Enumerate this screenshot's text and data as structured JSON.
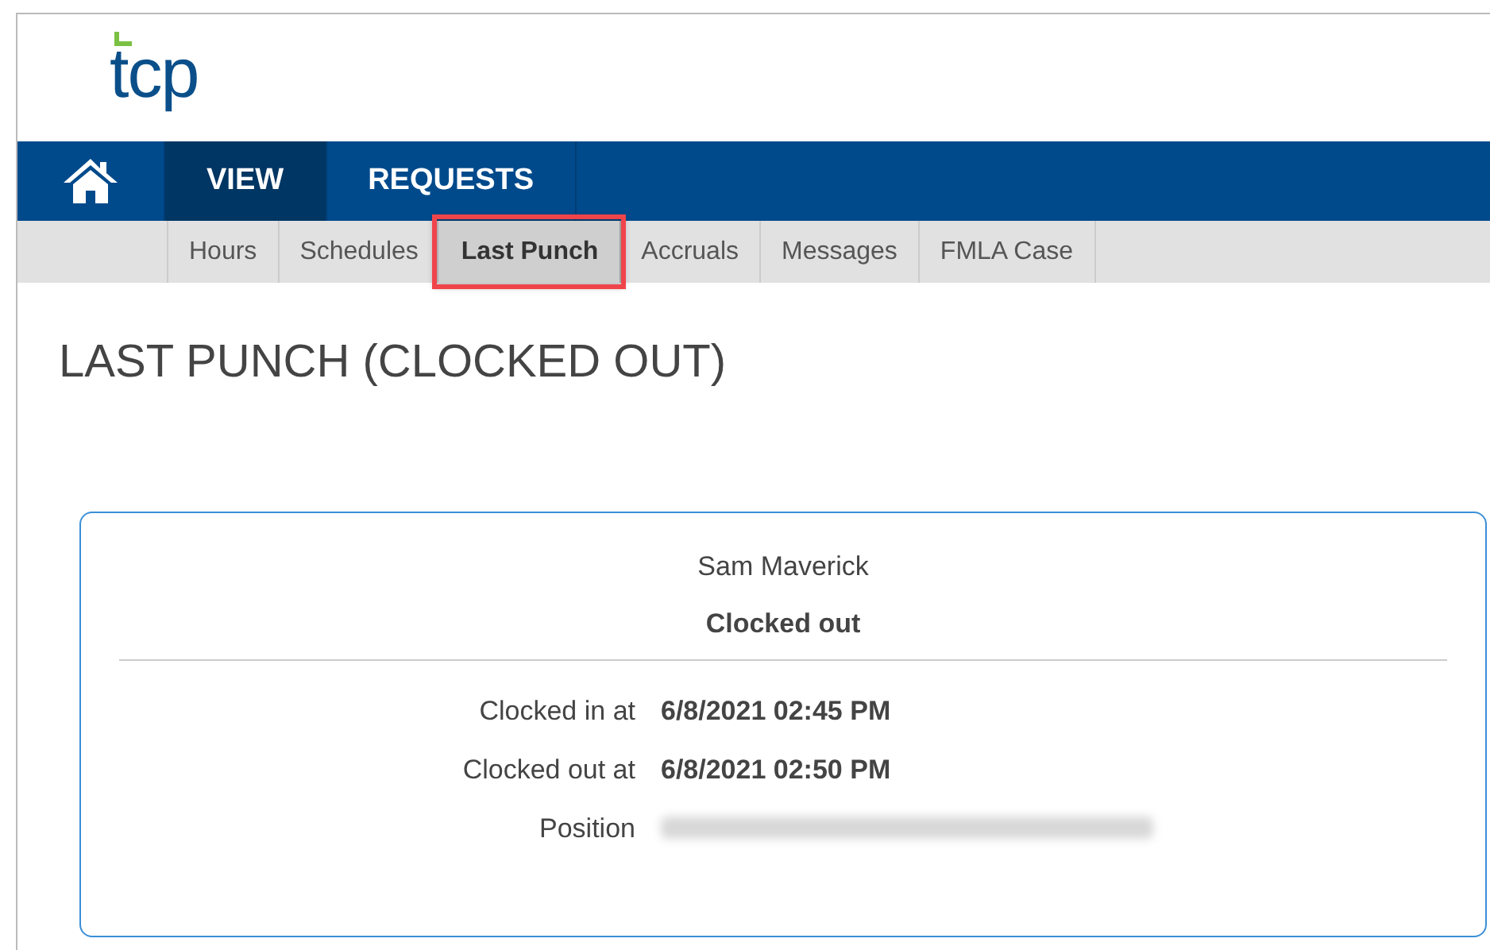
{
  "logo": {
    "text": "tcp"
  },
  "nav": {
    "items": [
      {
        "kind": "home",
        "selected": false
      },
      {
        "kind": "text",
        "label": "VIEW",
        "selected": true
      },
      {
        "kind": "text",
        "label": "REQUESTS",
        "selected": false
      }
    ]
  },
  "subnav": {
    "items": [
      {
        "label": "Hours",
        "selected": false,
        "highlighted": false
      },
      {
        "label": "Schedules",
        "selected": false,
        "highlighted": false
      },
      {
        "label": "Last Punch",
        "selected": true,
        "highlighted": true
      },
      {
        "label": "Accruals",
        "selected": false,
        "highlighted": false
      },
      {
        "label": "Messages",
        "selected": false,
        "highlighted": false
      },
      {
        "label": "FMLA Case",
        "selected": false,
        "highlighted": false
      }
    ]
  },
  "page_title": "LAST PUNCH (CLOCKED OUT)",
  "card": {
    "employee": "Sam Maverick",
    "status": "Clocked out",
    "rows": [
      {
        "kind": "text",
        "label": "Clocked in at",
        "value": "6/8/2021 02:45 PM"
      },
      {
        "kind": "text",
        "label": "Clocked out at",
        "value": "6/8/2021 02:50 PM"
      },
      {
        "kind": "redacted",
        "label": "Position"
      }
    ]
  }
}
